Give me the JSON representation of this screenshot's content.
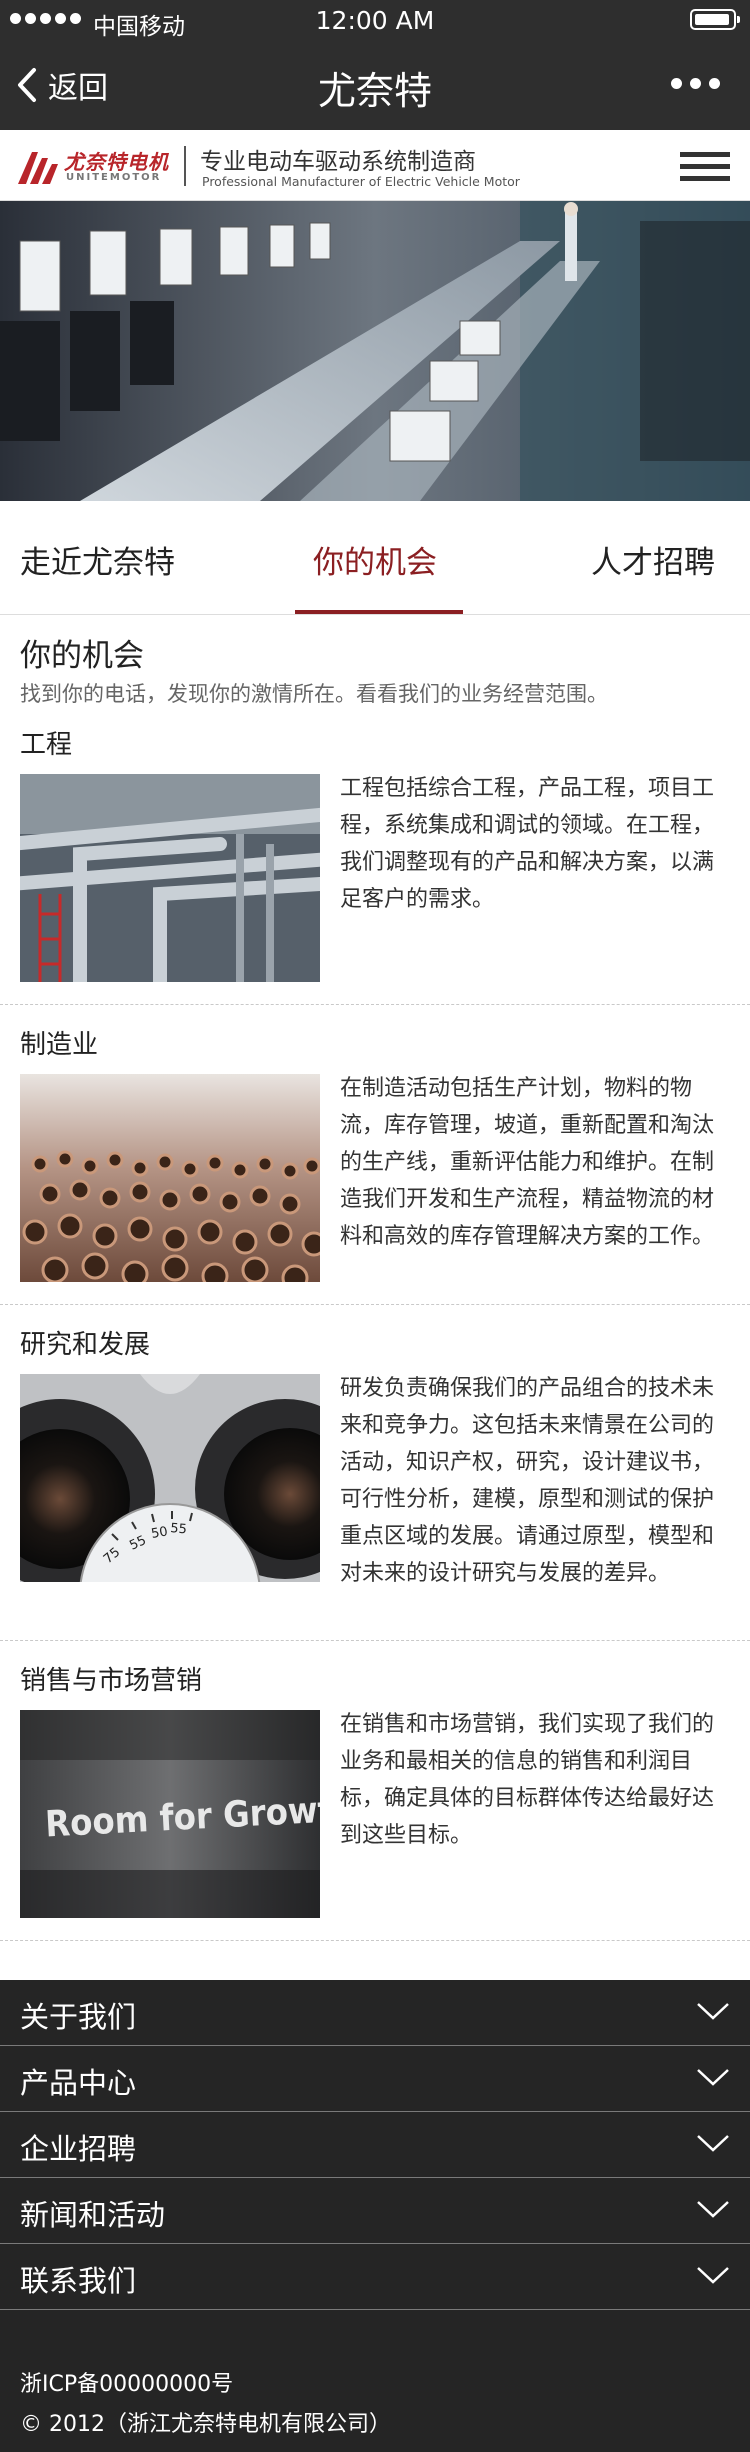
{
  "status_bar": {
    "carrier": "中国移动",
    "time": "12:00 AM"
  },
  "nav": {
    "back_label": "返回",
    "title": "尤奈特"
  },
  "brand": {
    "logo_cn": "尤奈特电机",
    "logo_en": "UNITEMOTOR",
    "tagline_cn": "专业电动车驱动系统制造商",
    "tagline_en": "Professional Manufacturer of Electric Vehicle Motor"
  },
  "tabs": [
    {
      "label": "走近尤奈特",
      "active": false
    },
    {
      "label": "你的机会",
      "active": true
    },
    {
      "label": "人才招聘",
      "active": false
    }
  ],
  "section": {
    "title": "你的机会",
    "intro": "找到你的电话，发现你的激情所在。看看我们的业务经营范围。"
  },
  "items": [
    {
      "title": "工程",
      "image": "pipes-image",
      "text": "工程包括综合工程，产品工程，项目工程，系统集成和调试的领域。在工程，我们调整现有的产品和解决方案，以满足客户的需求。"
    },
    {
      "title": "制造业",
      "image": "copper-tubes-image",
      "text": "在制造活动包括生产计划，物料的物流，库存管理，坡道，重新配置和淘汰的生产线，重新评估能力和维护。在制造我们开发和生产流程，精益物流的材料和高效的库存管理解决方案的工作。"
    },
    {
      "title": "研究和发展",
      "image": "binocular-image",
      "dial_labels": [
        "75",
        "55",
        "50",
        "55"
      ],
      "text": "研发负责确保我们的产品组合的技术未来和竞争力。这包括未来情景在公司的活动，知识产权，研究，设计建议书，可行性分析，建模，原型和测试的保护重点区域的发展。请通过原型，模型和对未来的设计研究与发展的差异。"
    },
    {
      "title": "销售与市场营销",
      "image": "room-for-growth-image",
      "image_text": "Room for Growth",
      "text": "在销售和市场营销，我们实现了我们的业务和最相关的信息的销售和利润目标，确定具体的目标群体传达给最好达到这些目标。"
    }
  ],
  "accordion": [
    {
      "label": "关于我们"
    },
    {
      "label": "产品中心"
    },
    {
      "label": "企业招聘"
    },
    {
      "label": "新闻和活动"
    },
    {
      "label": "联系我们"
    }
  ],
  "footer": {
    "icp": "浙ICP备00000000号",
    "copyright": "© 2012（浙江尤奈特电机有限公司）"
  },
  "colors": {
    "accent": "#8b1f22",
    "dark_bar": "#2e2e2e",
    "footer_bg": "#252525",
    "logo_red": "#b8252a"
  }
}
